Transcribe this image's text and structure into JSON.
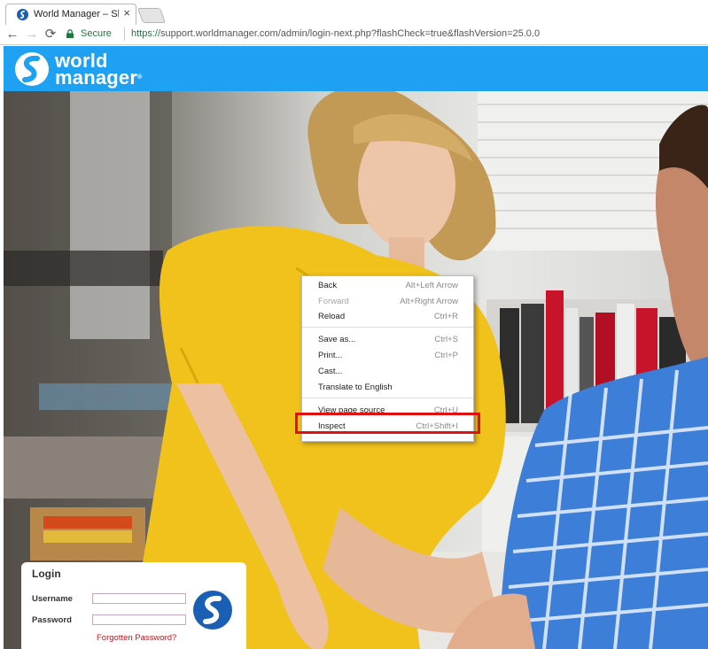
{
  "browser": {
    "tab_title": "World Manager – Showc",
    "tab_close": "×",
    "back_icon": "←",
    "forward_icon": "→",
    "reload_icon": "⟳",
    "secure_label": "Secure",
    "url_scheme": "https://",
    "url_host": "support.worldmanager.com",
    "url_rest": "/admin/login-next.php?flashCheck=true&flashVersion=25.0.0"
  },
  "site": {
    "logo_line1": "world",
    "logo_line2": "manager",
    "logo_reg": "®",
    "brand_color": "#1ea1f2"
  },
  "context_menu": {
    "items": [
      {
        "label": "Back",
        "shortcut": "Alt+Left Arrow",
        "disabled": false
      },
      {
        "label": "Forward",
        "shortcut": "Alt+Right Arrow",
        "disabled": true
      },
      {
        "label": "Reload",
        "shortcut": "Ctrl+R",
        "disabled": false
      },
      {
        "label": "Save as...",
        "shortcut": "Ctrl+S",
        "disabled": false
      },
      {
        "label": "Print...",
        "shortcut": "Ctrl+P",
        "disabled": false
      },
      {
        "label": "Cast...",
        "shortcut": "",
        "disabled": false
      },
      {
        "label": "Translate to English",
        "shortcut": "",
        "disabled": false
      },
      {
        "label": "View page source",
        "shortcut": "Ctrl+U",
        "disabled": false
      },
      {
        "label": "Inspect",
        "shortcut": "Ctrl+Shift+I",
        "disabled": false
      }
    ],
    "highlight_color": "#e01010"
  },
  "login": {
    "title": "Login",
    "username_label": "Username",
    "username_value": "",
    "password_label": "Password",
    "password_value": "",
    "forgot_link": "Forgotten Password?"
  }
}
